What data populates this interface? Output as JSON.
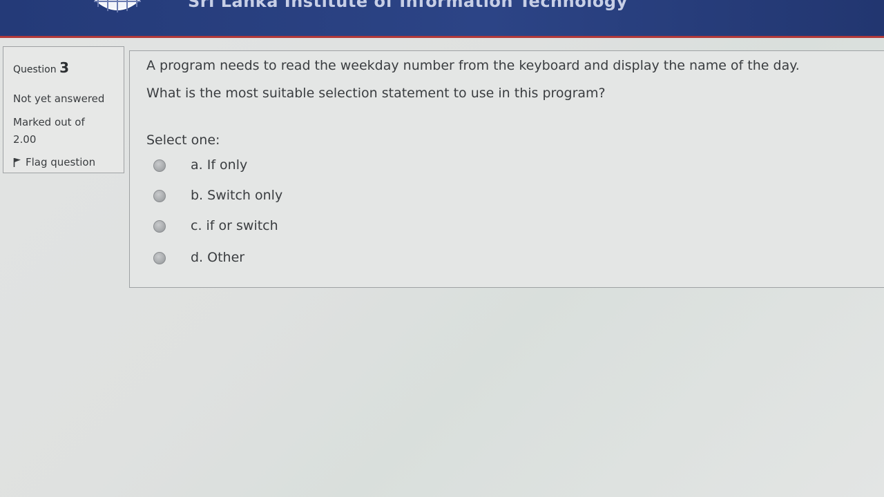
{
  "header": {
    "site_title": "Sri Lanka Institute of Information Technology"
  },
  "question_info": {
    "label": "Question",
    "number": "3",
    "state": "Not yet answered",
    "grade_label": "Marked out of",
    "grade_value": "2.00",
    "flag_label": "Flag question"
  },
  "question": {
    "text_line1": "A program needs to read the weekday number from the keyboard and display the name of the day.",
    "text_line2": "What is the most suitable selection statement to use in this program?",
    "prompt": "Select one:",
    "options": [
      {
        "label": "a. If only"
      },
      {
        "label": "b. Switch only"
      },
      {
        "label": "c. if  or switch"
      },
      {
        "label": "d. Other"
      }
    ]
  },
  "icons": {
    "logo": "crest-logo-icon",
    "flag": "flag-icon",
    "radio": "radio-button-icon"
  },
  "colors": {
    "header_bg": "#2c4486",
    "header_border": "#b23a3a",
    "page_bg": "#e2e4e3"
  }
}
